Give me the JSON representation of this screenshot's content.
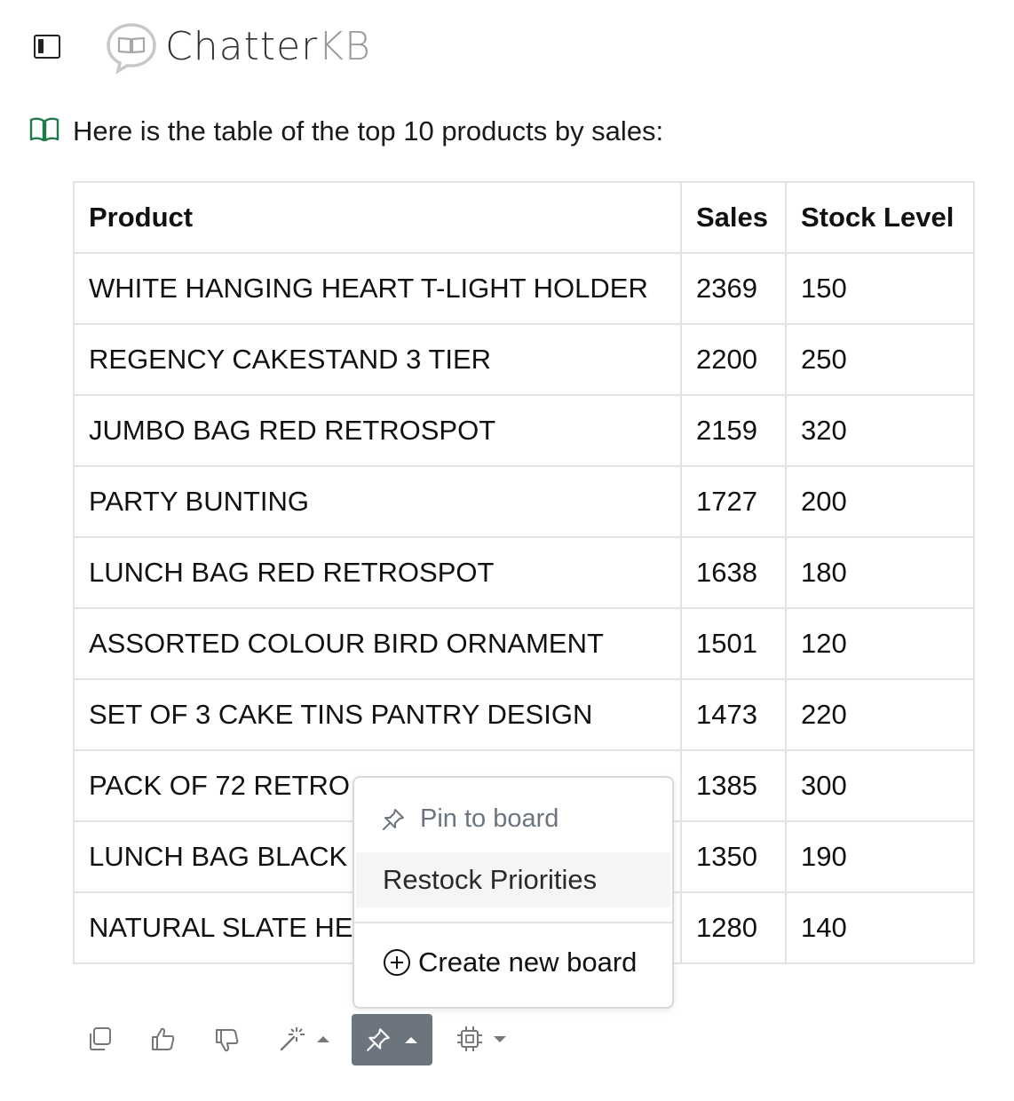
{
  "header": {
    "logo_primary": "Chatter",
    "logo_secondary": "KB",
    "logo_icon": "book-speech-bubble-icon"
  },
  "message": {
    "icon": "book-open-icon",
    "accent_color": "#1e7a4c",
    "intro": "Here is the table of the top 10 products by sales:"
  },
  "table": {
    "headers": [
      "Product",
      "Sales",
      "Stock Level"
    ],
    "rows": [
      [
        "WHITE HANGING HEART T-LIGHT HOLDER",
        "2369",
        "150"
      ],
      [
        "REGENCY CAKESTAND 3 TIER",
        "2200",
        "250"
      ],
      [
        "JUMBO BAG RED RETROSPOT",
        "2159",
        "320"
      ],
      [
        "PARTY BUNTING",
        "1727",
        "200"
      ],
      [
        "LUNCH BAG RED RETROSPOT",
        "1638",
        "180"
      ],
      [
        "ASSORTED COLOUR BIRD ORNAMENT",
        "1501",
        "120"
      ],
      [
        "SET OF 3 CAKE TINS PANTRY DESIGN",
        "1473",
        "220"
      ],
      [
        "PACK OF 72 RETRO",
        "1385",
        "300"
      ],
      [
        "LUNCH BAG BLACK",
        "1350",
        "190"
      ],
      [
        "NATURAL SLATE HE",
        "1280",
        "140"
      ]
    ]
  },
  "pin_menu": {
    "header": "Pin to board",
    "boards": [
      "Restock Priorities"
    ],
    "create_label": "Create new board"
  },
  "toolbar": {
    "buttons": [
      "copy-icon",
      "thumbs-up-icon",
      "thumbs-down-icon",
      "magic-wand-icon",
      "pin-icon",
      "cpu-icon"
    ],
    "active_color": "#6c757d"
  }
}
